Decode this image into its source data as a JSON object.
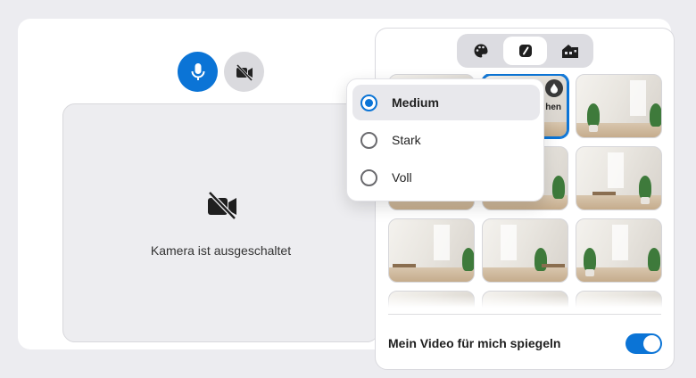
{
  "preview": {
    "camera_off_text": "Kamera ist ausgeschaltet"
  },
  "icons": {
    "mic": "microphone-icon",
    "camera_off": "video-off-icon",
    "palette": "palette-icon",
    "blur": "background-blur-icon",
    "room": "room-icon",
    "drop": "drop-icon"
  },
  "background_grid": {
    "selected_label_fragment": "hen"
  },
  "blur_options": [
    {
      "label": "Medium",
      "selected": true
    },
    {
      "label": "Stark",
      "selected": false
    },
    {
      "label": "Voll",
      "selected": false
    }
  ],
  "settings": {
    "mirror_label": "Mein Video für mich spiegeln",
    "mirror_on": true
  },
  "colors": {
    "accent": "#0b74d6",
    "surface": "#ffffff",
    "background": "#ececf0"
  }
}
